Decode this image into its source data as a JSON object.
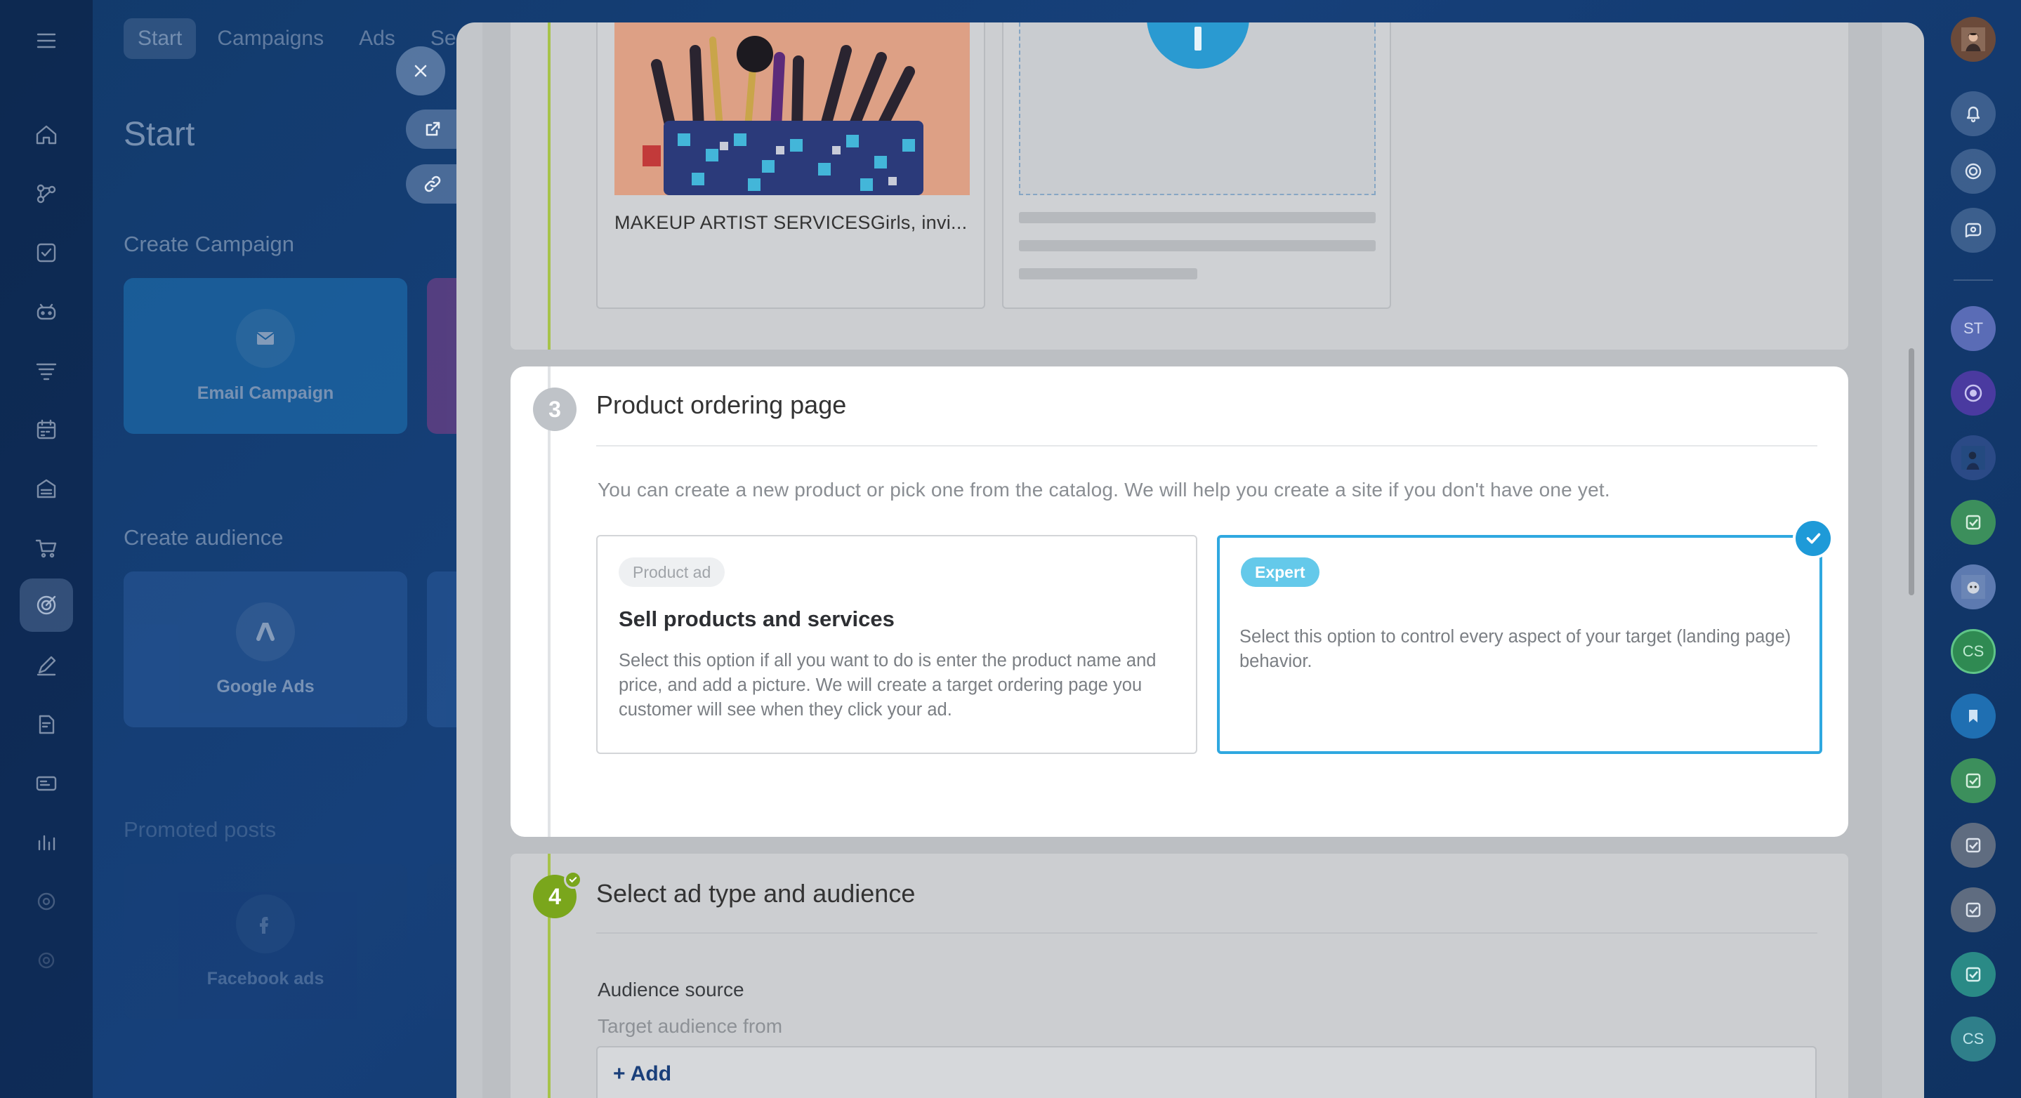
{
  "background_app": {
    "tabs": [
      "Start",
      "Campaigns",
      "Ads",
      "Se"
    ],
    "title": "Start",
    "create_campaign_heading": "Create Campaign",
    "email_campaign_label": "Email Campaign",
    "create_audience_heading": "Create audience",
    "google_ads_label": "Google Ads",
    "promoted_posts_heading": "Promoted posts",
    "facebook_ads_label": "Facebook ads"
  },
  "slider": {
    "step2": {
      "site_card_caption": "MAKEUP ARTIST SERVICESGirls, invi..."
    },
    "step3": {
      "number": "3",
      "title": "Product ordering page",
      "description": "You can create a new product or pick one from the catalog. We will help you create a site if you don't have one yet.",
      "options": [
        {
          "pill": "Product ad",
          "title": "Sell products and services",
          "description": "Select this option if all you want to do is enter the product name and price, and add a picture. We will create a target ordering page you customer will see when they click your ad.",
          "selected": false
        },
        {
          "pill": "Expert",
          "title": "",
          "description": "Select this option to control every aspect of your target (landing page) behavior.",
          "selected": true
        }
      ]
    },
    "step4": {
      "number": "4",
      "title": "Select ad type and audience",
      "audience_source_label": "Audience source",
      "target_audience_label": "Target audience from",
      "add_button": "+ Add"
    }
  },
  "right_rail": {
    "avatar_initials": [
      "ST",
      "CS",
      "CS"
    ]
  },
  "colors": {
    "accent_blue": "#2fa8e0",
    "check_blue": "#1e9ad8",
    "step_done_green": "#7aa61c",
    "timeline_green": "#a7c34a",
    "pill_expert": "#64c9ea"
  }
}
